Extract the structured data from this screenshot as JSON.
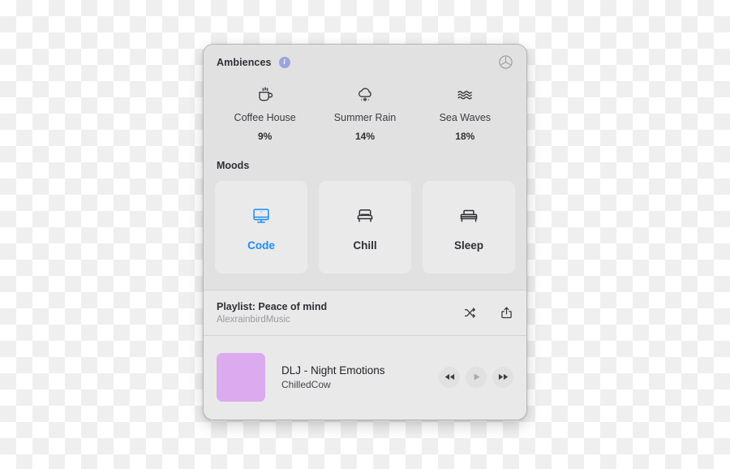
{
  "window": {
    "title": "Ambiences"
  },
  "header": {
    "title": "Ambiences",
    "info_icon": "info-circle-icon",
    "info_glyph": "i",
    "power_icon": "power-toggle-icon"
  },
  "ambiences": {
    "items": [
      {
        "label": "Coffee House",
        "value": "9%",
        "icon": "coffee-cup-icon"
      },
      {
        "label": "Summer Rain",
        "value": "14%",
        "icon": "rain-cloud-icon"
      },
      {
        "label": "Sea Waves",
        "value": "18%",
        "icon": "waves-icon"
      }
    ]
  },
  "moods": {
    "title": "Moods",
    "active_color": "#1a8cff",
    "items": [
      {
        "label": "Code",
        "icon": "desktop-monitor-icon",
        "active": true
      },
      {
        "label": "Chill",
        "icon": "armchair-icon",
        "active": false
      },
      {
        "label": "Sleep",
        "icon": "bed-icon",
        "active": false
      }
    ]
  },
  "playlist": {
    "name": "Playlist: Peace of mind",
    "author": "AlexrainbirdMusic",
    "shuffle_icon": "shuffle-icon",
    "share_icon": "share-icon"
  },
  "now_playing": {
    "album_art_color": "#dcabef",
    "track_title": "DLJ - Night Emotions",
    "track_artist": "ChilledCow",
    "controls": [
      {
        "name": "rewind-button",
        "icon": "rewind-icon"
      },
      {
        "name": "play-button",
        "icon": "play-icon"
      },
      {
        "name": "forward-button",
        "icon": "fast-forward-icon"
      }
    ]
  }
}
